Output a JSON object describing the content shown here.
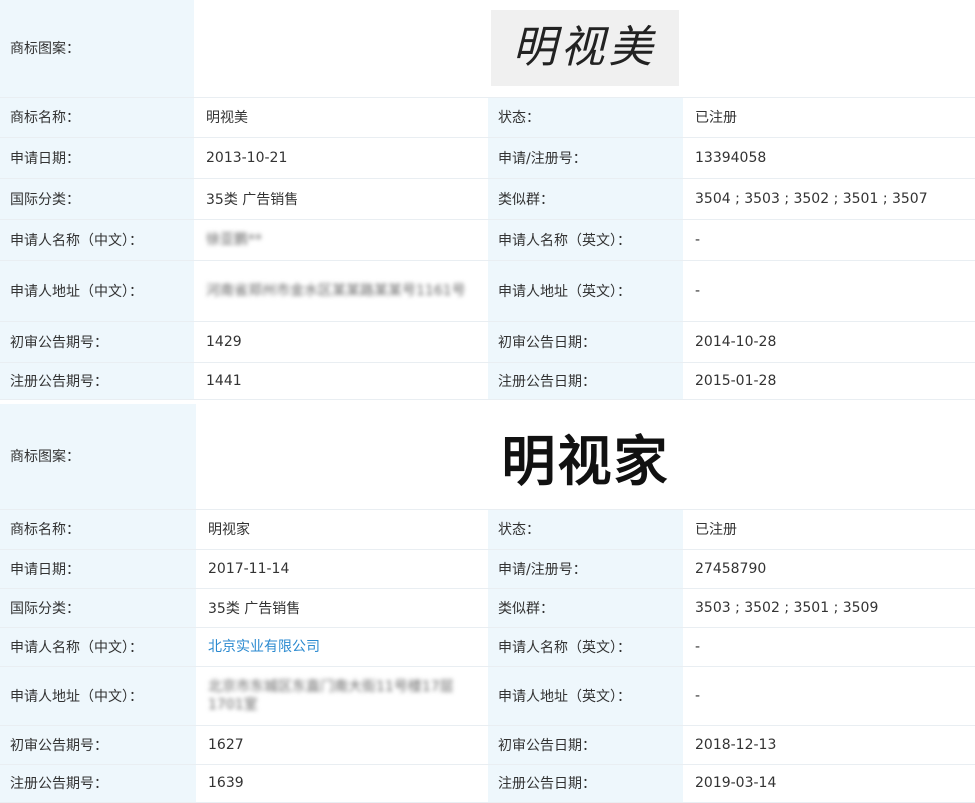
{
  "records": [
    {
      "logo_label": "商标图案：",
      "logo_text": "明视美",
      "rows": [
        [
          {
            "label": "商标名称：",
            "value": "明视美"
          },
          {
            "label": "状态：",
            "value": "已注册"
          }
        ],
        [
          {
            "label": "申请日期：",
            "value": "2013-10-21"
          },
          {
            "label": "申请/注册号：",
            "value": "13394058"
          }
        ],
        [
          {
            "label": "国际分类：",
            "value": "35类 广告销售"
          },
          {
            "label": "类似群：",
            "value": "3504 ; 3503 ; 3502 ; 3501 ; 3507"
          }
        ],
        [
          {
            "label": "申请人名称（中文）：",
            "value": "徐亚鹏**"
          },
          {
            "label": "申请人名称（英文）：",
            "value": "-"
          }
        ],
        [
          {
            "label": "申请人地址（中文）：",
            "value": "河南省郑州市金水区某某路某某号1161号"
          },
          {
            "label": "申请人地址（英文）：",
            "value": "-"
          }
        ],
        [
          {
            "label": "初审公告期号：",
            "value": "1429"
          },
          {
            "label": "初审公告日期：",
            "value": "2014-10-28"
          }
        ],
        [
          {
            "label": "注册公告期号：",
            "value": "1441"
          },
          {
            "label": "注册公告日期：",
            "value": "2015-01-28"
          }
        ]
      ]
    },
    {
      "logo_label": "商标图案：",
      "logo_text": "明视家",
      "rows": [
        [
          {
            "label": "商标名称：",
            "value": "明视家"
          },
          {
            "label": "状态：",
            "value": "已注册"
          }
        ],
        [
          {
            "label": "申请日期：",
            "value": "2017-11-14"
          },
          {
            "label": "申请/注册号：",
            "value": "27458790"
          }
        ],
        [
          {
            "label": "国际分类：",
            "value": "35类 广告销售"
          },
          {
            "label": "类似群：",
            "value": "3503 ; 3502 ; 3501 ; 3509"
          }
        ],
        [
          {
            "label": "申请人名称（中文）：",
            "value": "北京实业有限公司"
          },
          {
            "label": "申请人名称（英文）：",
            "value": "-"
          }
        ],
        [
          {
            "label": "申请人地址（中文）：",
            "value": "北京市东城区东直门南大街11号楼17层1701室"
          },
          {
            "label": "申请人地址（英文）：",
            "value": "-"
          }
        ],
        [
          {
            "label": "初审公告期号：",
            "value": "1627"
          },
          {
            "label": "初审公告日期：",
            "value": "2018-12-13"
          }
        ],
        [
          {
            "label": "注册公告期号：",
            "value": "1639"
          },
          {
            "label": "注册公告日期：",
            "value": "2019-03-14"
          }
        ]
      ]
    }
  ]
}
